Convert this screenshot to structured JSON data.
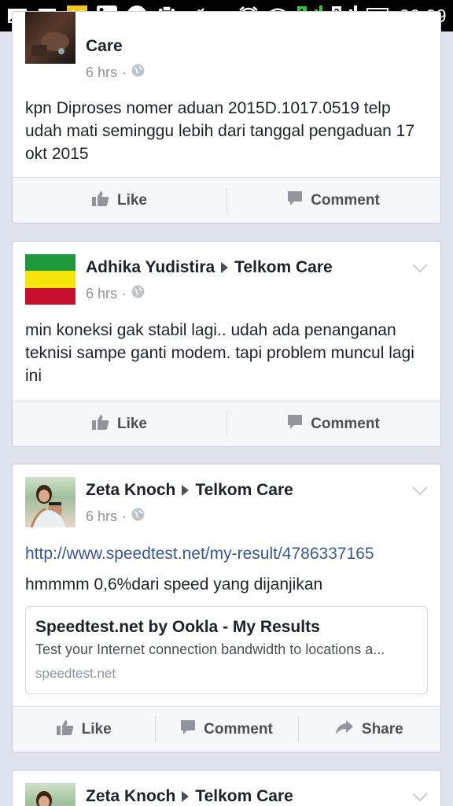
{
  "status_bar": {
    "time": "00.09",
    "notification_icons": [
      "gallery-icon",
      "bbm-icon",
      "sponge-icon",
      "linkedin-icon",
      "olx-icon",
      "clipboard-icon",
      "mute-icon"
    ],
    "system_icons": [
      "alarm-icon",
      "wifi-icon",
      "signal-1-icon",
      "signal-2-icon",
      "battery-icon"
    ],
    "signal_1_badge": "1",
    "signal_2_badge": "2"
  },
  "posts": [
    {
      "author": "",
      "page": "Care",
      "time": "6 hrs",
      "text": "kpn Diproses nomer aduan 2015D.1017.0519 telp udah mati seminggu lebih dari tanggal pengaduan 17 okt 2015",
      "actions": [
        "Like",
        "Comment"
      ]
    },
    {
      "author": "Adhika Yudistira",
      "page": "Telkom Care",
      "time": "6 hrs",
      "text": "min koneksi gak stabil lagi.. udah ada penanganan teknisi sampe ganti modem. tapi problem muncul lagi ini",
      "actions": [
        "Like",
        "Comment"
      ]
    },
    {
      "author": "Zeta Knoch",
      "page": "Telkom Care",
      "time": "6 hrs",
      "link": "http://www.speedtest.net/my-result/4786337165",
      "text": "hmmmm 0,6%dari speed yang dijanjikan",
      "preview": {
        "title": "Speedtest.net by Ookla - My Results",
        "description": "Test your Internet connection bandwidth to locations a...",
        "domain": "speedtest.net"
      },
      "actions": [
        "Like",
        "Comment",
        "Share"
      ]
    },
    {
      "author": "Zeta Knoch",
      "page": "Telkom Care"
    }
  ],
  "colors": {
    "feed_background": "#dfe3ee",
    "link": "#365899",
    "meta": "#90949c",
    "action_text": "#4b4f56",
    "flag_green": "#1e9a3c",
    "flag_yellow": "#f5e50a",
    "flag_red": "#c8102e"
  }
}
